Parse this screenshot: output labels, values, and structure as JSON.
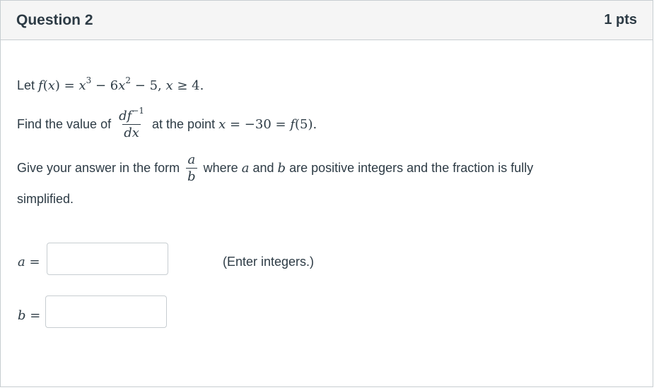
{
  "header": {
    "title": "Question 2",
    "points": "1 pts"
  },
  "question": {
    "line1_prefix": "Let",
    "line1_math": "f(x) = x³ − 6x² − 5, x ≥ 4.",
    "line2_prefix": "Find the value of",
    "deriv_num": "df⁻¹",
    "deriv_den": "dx",
    "line2_suffix": "at the point",
    "line2_math": "x = −30 = f(5).",
    "line3_prefix": "Give your answer in the form",
    "form_num": "a",
    "form_den": "b",
    "line3_mid1": "where",
    "var_a": "a",
    "line3_mid2": "and",
    "var_b": "b",
    "line3_suffix": "are positive integers and the fraction is fully",
    "line4": "simplified."
  },
  "answers": {
    "a_label": "a",
    "b_label": "b",
    "equals": "=",
    "a_value": "",
    "b_value": "",
    "hint": "(Enter integers.)"
  }
}
